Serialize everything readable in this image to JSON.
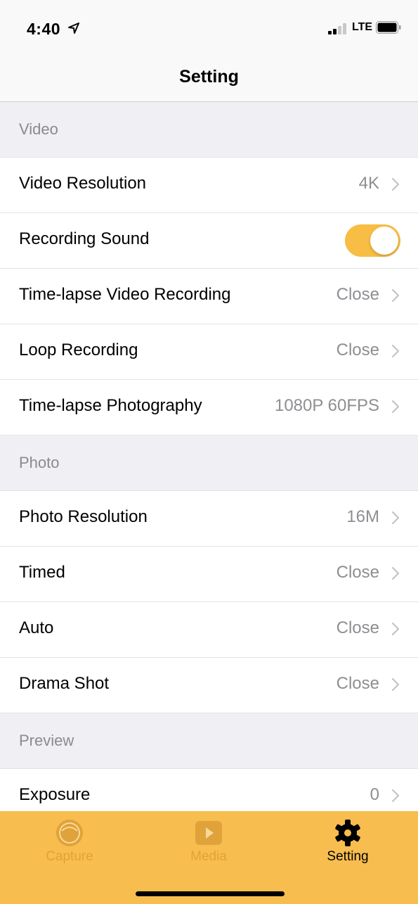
{
  "status_bar": {
    "time": "4:40",
    "network": "LTE"
  },
  "nav": {
    "title": "Setting"
  },
  "sections": {
    "video": {
      "header": "Video",
      "video_resolution": {
        "label": "Video Resolution",
        "value": "4K"
      },
      "recording_sound": {
        "label": "Recording Sound",
        "enabled": true
      },
      "timelapse_video": {
        "label": "Time-lapse Video Recording",
        "value": "Close"
      },
      "loop_recording": {
        "label": "Loop Recording",
        "value": "Close"
      },
      "timelapse_photo": {
        "label": "Time-lapse Photography",
        "value": "1080P 60FPS"
      }
    },
    "photo": {
      "header": "Photo",
      "photo_resolution": {
        "label": "Photo Resolution",
        "value": "16M"
      },
      "timed": {
        "label": "Timed",
        "value": "Close"
      },
      "auto": {
        "label": "Auto",
        "value": "Close"
      },
      "drama_shot": {
        "label": "Drama Shot",
        "value": "Close"
      }
    },
    "preview": {
      "header": "Preview",
      "exposure": {
        "label": "Exposure",
        "value": "0"
      }
    }
  },
  "tab_bar": {
    "tabs": [
      {
        "label": "Capture",
        "icon": "capture-icon",
        "active": false
      },
      {
        "label": "Media",
        "icon": "media-play-icon",
        "active": false
      },
      {
        "label": "Setting",
        "icon": "gear-icon",
        "active": true
      }
    ]
  },
  "colors": {
    "accent": "#f8bd44",
    "tab_bar_bg": "#f8bd4f",
    "inactive_tab": "#e0a23a",
    "section_bg": "#efeff4"
  }
}
